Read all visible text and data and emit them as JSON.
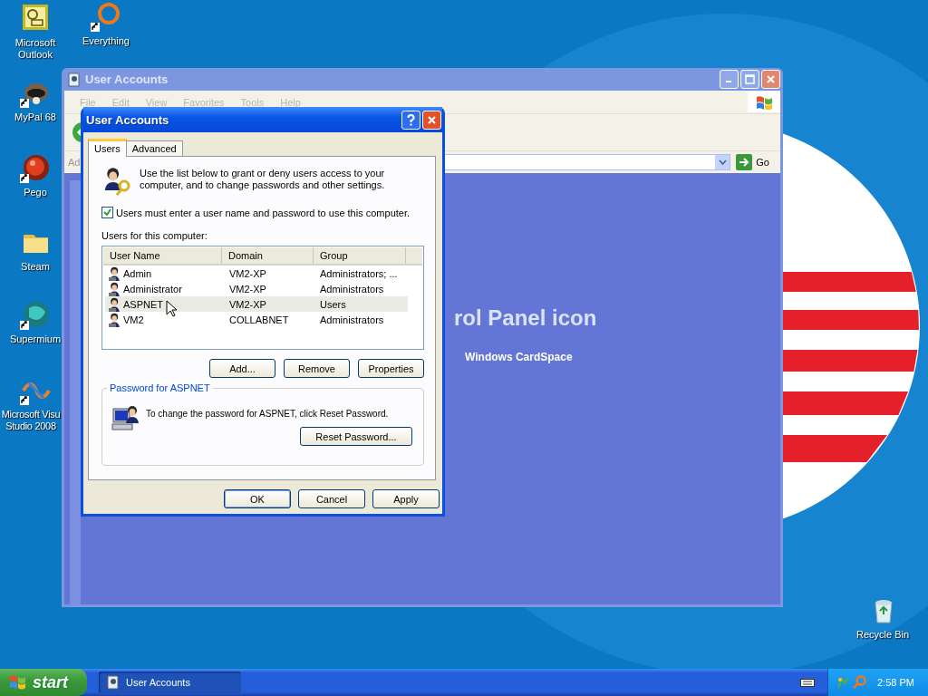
{
  "desktop_icons": [
    {
      "label": "Microsoft Outlook",
      "shortcut": false
    },
    {
      "label": "Everything",
      "shortcut": true
    },
    {
      "label": "MyPal 68",
      "shortcut": true
    },
    {
      "label": "Pego",
      "shortcut": true
    },
    {
      "label": "Steam",
      "shortcut": false
    },
    {
      "label": "Supermium",
      "shortcut": true
    },
    {
      "label": "Microsoft Visu Studio 2008",
      "shortcut": true
    },
    {
      "label": "Recycle Bin",
      "shortcut": false
    }
  ],
  "background_window": {
    "title": "User Accounts",
    "menu": [
      {
        "label": "File",
        "disabled": true
      },
      {
        "label": "Edit",
        "disabled": true
      },
      {
        "label": "View",
        "disabled": true
      },
      {
        "label": "Favorites",
        "disabled": true
      },
      {
        "label": "Tools",
        "disabled": true
      },
      {
        "label": "Help",
        "disabled": true
      }
    ],
    "address_label": "Ad",
    "go_button": "Go",
    "heading": "rol Panel icon",
    "link": "Windows CardSpace"
  },
  "dialog": {
    "title": "User Accounts",
    "tabs": [
      {
        "label": "Users",
        "selected": true
      },
      {
        "label": "Advanced",
        "selected": false
      }
    ],
    "intro": "Use the list below to grant or deny users access to your computer, and to change passwords and other settings.",
    "require_login": {
      "label": "Users must enter a user name and password to use this computer.",
      "checked": true
    },
    "list_label": "Users for this computer:",
    "columns": [
      "User Name",
      "Domain",
      "Group"
    ],
    "rows": [
      {
        "user_name": "Admin",
        "domain": "VM2-XP",
        "group": "Administrators; ...",
        "selected": false
      },
      {
        "user_name": "Administrator",
        "domain": "VM2-XP",
        "group": "Administrators",
        "selected": false
      },
      {
        "user_name": "ASPNET",
        "domain": "VM2-XP",
        "group": "Users",
        "selected": true
      },
      {
        "user_name": "VM2",
        "domain": "COLLABNET",
        "group": "Administrators",
        "selected": false
      }
    ],
    "list_buttons": [
      "Add...",
      "Remove",
      "Properties"
    ],
    "password_group": {
      "title": "Password for ASPNET",
      "text": "To change the password for ASPNET, click Reset Password.",
      "button": "Reset Password..."
    },
    "footer_buttons": [
      {
        "label": "OK",
        "default": true
      },
      {
        "label": "Cancel",
        "default": false
      },
      {
        "label": "Apply",
        "default": false
      }
    ]
  },
  "taskbar": {
    "start": "start",
    "tasks": [
      {
        "label": "User Accounts",
        "active": true
      }
    ],
    "clock": "2:58 PM"
  }
}
